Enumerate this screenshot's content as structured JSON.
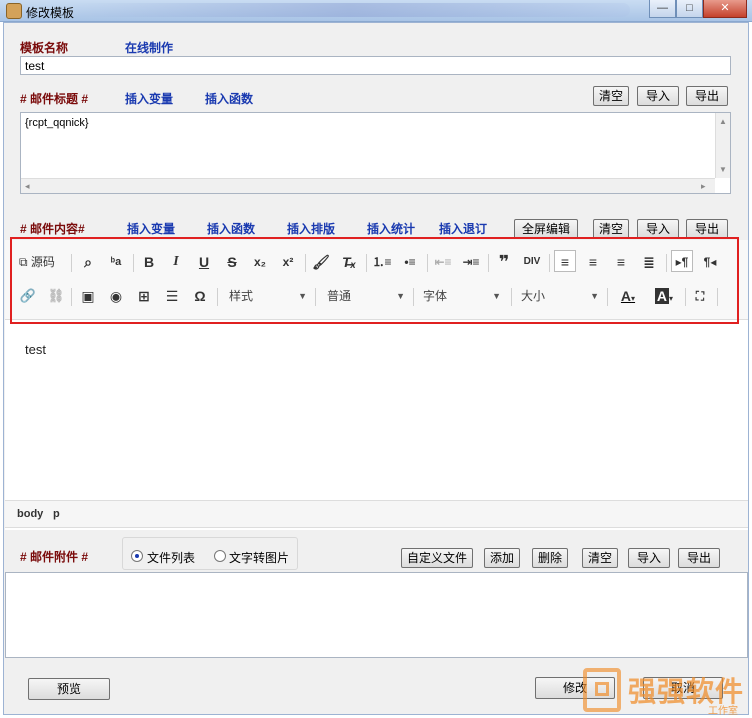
{
  "window": {
    "title": "修改模板",
    "close": "✕",
    "min": "—",
    "max": "□"
  },
  "template_name": {
    "label": "模板名称",
    "online_link": "在线制作",
    "value": "test"
  },
  "subject": {
    "label": "# 邮件标题 #",
    "insert_var": "插入变量",
    "insert_func": "插入函数",
    "clear": "清空",
    "import": "导入",
    "export": "导出",
    "value": "{rcpt_qqnick}"
  },
  "content": {
    "label": "# 邮件内容#",
    "insert_var": "插入变量",
    "insert_func": "插入函数",
    "insert_layout": "插入排版",
    "insert_stats": "插入统计",
    "insert_unsub": "插入退订",
    "fullscreen": "全屏编辑",
    "clear": "清空",
    "import": "导入",
    "export": "导出"
  },
  "toolbar": {
    "source": "源码",
    "style_combo": "样式",
    "format_combo": "普通",
    "font_combo": "字体",
    "size_combo": "大小"
  },
  "editor": {
    "body_text": "test",
    "path_body": "body",
    "path_p": "p"
  },
  "attachments": {
    "label": "# 邮件附件 #",
    "radio_files": "文件列表",
    "radio_text_to_image": "文字转图片",
    "custom": "自定义文件",
    "add": "添加",
    "delete": "删除",
    "clear": "清空",
    "import": "导入",
    "export": "导出"
  },
  "footer": {
    "preview": "预览",
    "modify": "修改",
    "cancel": "取消"
  },
  "watermark": {
    "brand": "强强软件",
    "sub": "工作室"
  }
}
